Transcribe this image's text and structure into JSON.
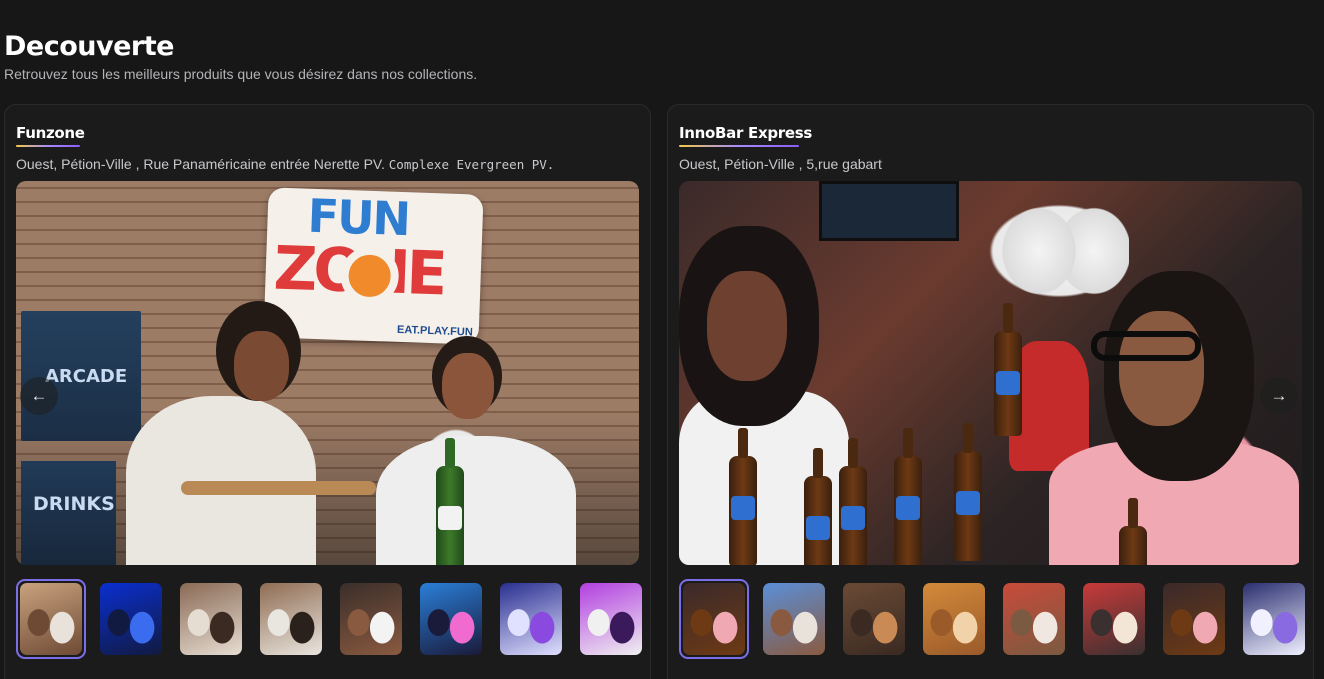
{
  "page": {
    "title": "Decouverte",
    "subtitle": "Retrouvez tous les meilleurs produits que vous désirez dans nos collections."
  },
  "venues": [
    {
      "name": "Funzone",
      "address": "Ouest, Pétion-Ville , Rue Panaméricaine entrée Nerette PV.",
      "address_extra": "Complexe Evergreen PV.",
      "sign": {
        "line1": "FUN",
        "line2": "ZONE",
        "tagline": "EAT.PLAY.FUN"
      },
      "wall_signs": [
        "ARCADE",
        "DRINKS"
      ],
      "thumbnails": [
        {
          "colors": [
            "#c9a27e",
            "#e8e2da",
            "#6e4a35"
          ]
        },
        {
          "colors": [
            "#0a2fd0",
            "#3b6cf0",
            "#111a40"
          ]
        },
        {
          "colors": [
            "#8a6a55",
            "#3a2a22",
            "#e6ddd2"
          ]
        },
        {
          "colors": [
            "#8f6c52",
            "#2b211c",
            "#e9e5df"
          ]
        },
        {
          "colors": [
            "#3a2e2a",
            "#f3f3f3",
            "#8a5a40"
          ]
        },
        {
          "colors": [
            "#2a7fd8",
            "#f06ad0",
            "#1a1a3a"
          ]
        },
        {
          "colors": [
            "#2a2f8f",
            "#8a4ae0",
            "#e0e0ff"
          ]
        },
        {
          "colors": [
            "#b23fe0",
            "#3a1a5a",
            "#f0f0f0"
          ]
        }
      ]
    },
    {
      "name": "InnoBar Express",
      "address": "Ouest, Pétion-Ville , 5,rue gabart",
      "thumbnails": [
        {
          "colors": [
            "#3a2a2a",
            "#f0a8b3",
            "#6e3a14"
          ]
        },
        {
          "colors": [
            "#5a8fd8",
            "#e8e2da",
            "#8a5a40"
          ]
        },
        {
          "colors": [
            "#6a4a35",
            "#c98a55",
            "#3a2a22"
          ]
        },
        {
          "colors": [
            "#d48a3a",
            "#f2d2a8",
            "#9a5a2a"
          ]
        },
        {
          "colors": [
            "#c94a3a",
            "#f0e8e0",
            "#7a5a40"
          ]
        },
        {
          "colors": [
            "#c93a3a",
            "#f3e6d6",
            "#3a3030"
          ]
        },
        {
          "colors": [
            "#3a2a2a",
            "#f0a8b3",
            "#6e3a14"
          ]
        },
        {
          "colors": [
            "#2a2f6f",
            "#8a6ae0",
            "#f0f0ff"
          ]
        }
      ]
    }
  ],
  "nav": {
    "prev_icon": "←",
    "next_icon": "→"
  }
}
